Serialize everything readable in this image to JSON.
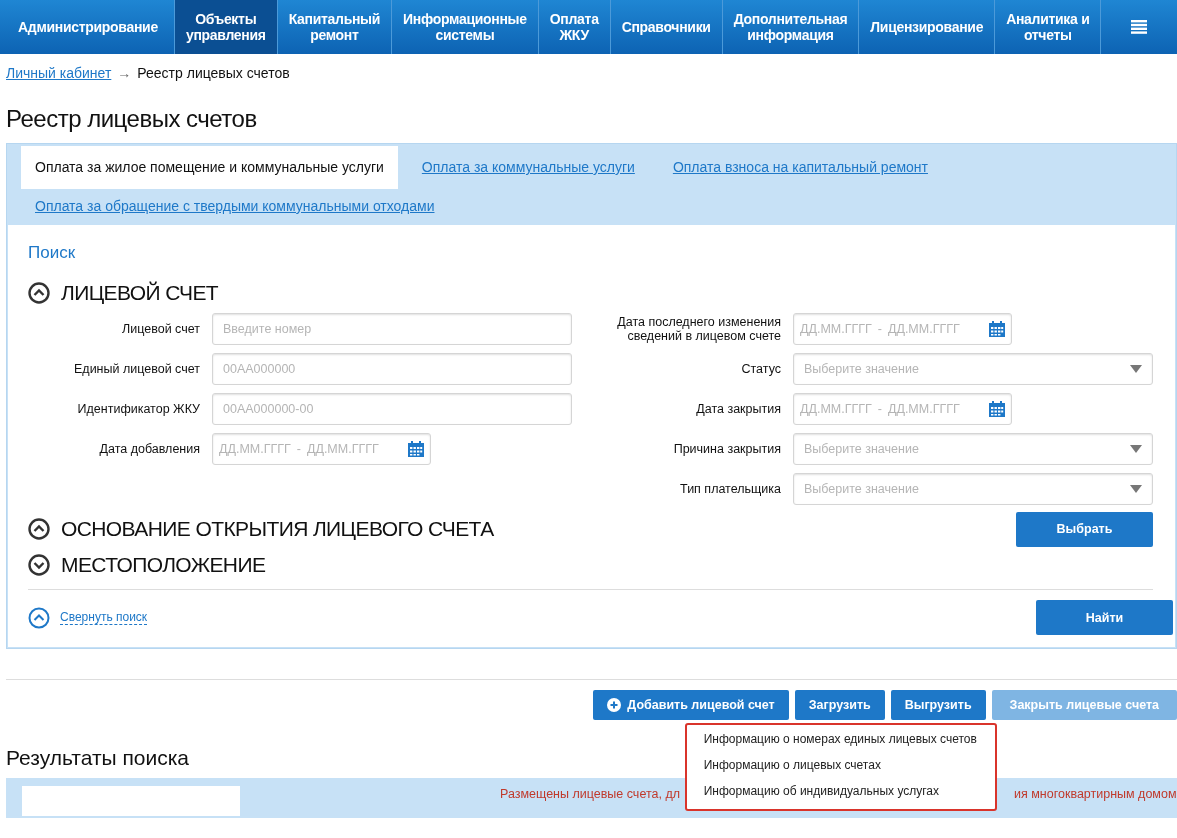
{
  "nav": {
    "items": [
      {
        "label": "Администрирование",
        "selected": false
      },
      {
        "label": "Объекты\nуправления",
        "selected": true
      },
      {
        "label": "Капитальный\nремонт",
        "selected": false
      },
      {
        "label": "Информационные\nсистемы",
        "selected": false
      },
      {
        "label": "Оплата\nЖКУ",
        "selected": false
      },
      {
        "label": "Справочники",
        "selected": false
      },
      {
        "label": "Дополнительная\nинформация",
        "selected": false
      },
      {
        "label": "Лицензирование",
        "selected": false
      },
      {
        "label": "Аналитика и\nотчеты",
        "selected": false
      }
    ]
  },
  "breadcrumbs": {
    "link": "Личный кабинет",
    "arrow": "→",
    "current": "Реестр лицевых счетов"
  },
  "page_title": "Реестр лицевых счетов",
  "tabs": [
    {
      "label": "Оплата за жилое помещение и коммунальные услуги",
      "selected": true
    },
    {
      "label": "Оплата за коммунальные услуги",
      "selected": false
    },
    {
      "label": "Оплата взноса на капитальный ремонт",
      "selected": false
    },
    {
      "label": "Оплата за обращение с твердыми коммунальными отходами",
      "selected": false
    }
  ],
  "search": {
    "title": "Поиск",
    "sections": [
      {
        "title": "ЛИЦЕВОЙ СЧЕТ",
        "expanded": true
      },
      {
        "title": "ОСНОВАНИЕ ОТКРЫТИЯ ЛИЦЕВОГО СЧЕТА",
        "expanded": true
      },
      {
        "title": "МЕСТОПОЛОЖЕНИЕ",
        "expanded": false
      }
    ],
    "left_fields": [
      {
        "kind": "text",
        "label": "Лицевой счет",
        "placeholder": "Введите номер"
      },
      {
        "kind": "text",
        "label": "Единый лицевой счет",
        "placeholder": "00АА000000"
      },
      {
        "kind": "text",
        "label": "Идентификатор ЖКУ",
        "placeholder": "00АА000000-00"
      },
      {
        "kind": "date_range",
        "label": "Дата добавления",
        "from_placeholder": "ДД.ММ.ГГГГ",
        "separator": "-",
        "to_placeholder": "ДД.ММ.ГГГГ"
      }
    ],
    "right_fields": [
      {
        "kind": "date_range",
        "label": "Дата последнего изменения сведений в лицевом счете",
        "from_placeholder": "ДД.ММ.ГГГГ",
        "separator": "-",
        "to_placeholder": "ДД.ММ.ГГГГ"
      },
      {
        "kind": "select",
        "label": "Статус",
        "placeholder": "Выберите значение"
      },
      {
        "kind": "date_range",
        "label": "Дата закрытия",
        "from_placeholder": "ДД.ММ.ГГГГ",
        "separator": "-",
        "to_placeholder": "ДД.ММ.ГГГГ"
      },
      {
        "kind": "select",
        "label": "Причина закрытия",
        "placeholder": "Выберите значение"
      },
      {
        "kind": "select",
        "label": "Тип плательщика",
        "placeholder": "Выберите значение"
      }
    ],
    "choose_button": "Выбрать",
    "collapse_link": "Свернуть поиск",
    "find_button": "Найти"
  },
  "actions": [
    {
      "label": "Добавить лицевой счет",
      "kind": "add",
      "disabled": false
    },
    {
      "label": "Загрузить",
      "kind": "plain",
      "disabled": false
    },
    {
      "label": "Выгрузить",
      "kind": "menu",
      "disabled": false
    },
    {
      "label": "Закрыть лицевые счета",
      "kind": "plain",
      "disabled": true
    }
  ],
  "export_menu": [
    "Информацию о номерах единых лицевых счетов",
    "Информацию о лицевых счетах",
    "Информацию об индивидуальных услугах"
  ],
  "results": {
    "title": "Результаты поиска",
    "notice_start": "Размещены лицевые счета, дл",
    "notice_end": "ия многоквартирным домом"
  }
}
